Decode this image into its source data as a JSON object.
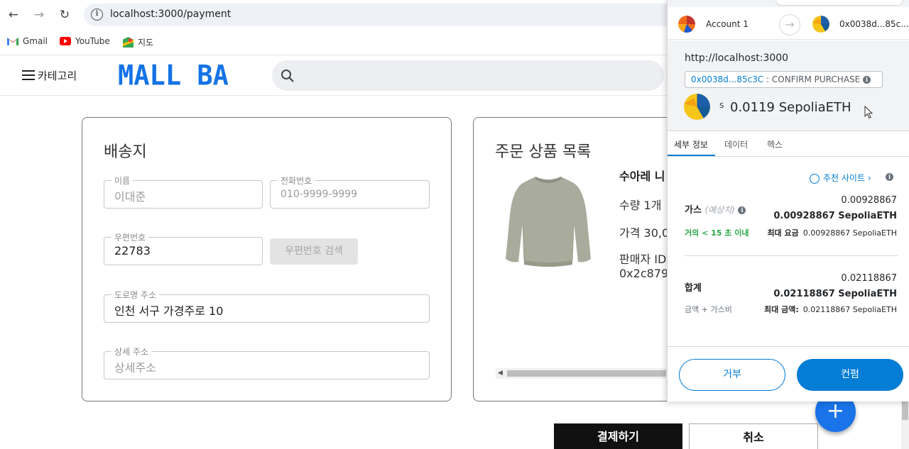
{
  "browser": {
    "url": "localhost:3000/payment",
    "bookmarks": [
      {
        "label": "Gmail",
        "icon": "gmail-icon"
      },
      {
        "label": "YouTube",
        "icon": "youtube-icon"
      },
      {
        "label": "지도",
        "icon": "maps-icon"
      }
    ]
  },
  "site": {
    "category_label": "카테고리",
    "logo": "MALL BA"
  },
  "shipping": {
    "title": "배송지",
    "name_label": "이름",
    "name_placeholder": "이대준",
    "phone_label": "전화번호",
    "phone_placeholder": "010-9999-9999",
    "zip_label": "우편번호",
    "zip_value": "22783",
    "zip_search_button": "우편번호 검색",
    "road_label": "도로명 주소",
    "road_value": "인천 서구 가경주로 10",
    "detail_label": "상세 주소",
    "detail_placeholder": "상세주소"
  },
  "order": {
    "title": "주문 상품 목록",
    "product_name": "수아레 니",
    "quantity": "수량 1개",
    "price": "가격 30,0",
    "seller_label": "판매자 ID",
    "seller_id": "0x2c879"
  },
  "actions": {
    "pay": "결제하기",
    "cancel": "취소",
    "fab": "+"
  },
  "metamask": {
    "account_name": "Account 1",
    "to_address": "0x0038d...85c...",
    "origin": "http://localhost:3000",
    "method_address": "0x0038d...85c3C",
    "method_label": ": CONFIRM PURCHASE",
    "amount_symbol": "S",
    "amount": "0.0119 SepoliaETH",
    "tabs": [
      "세부 정보",
      "데이터",
      "헥스"
    ],
    "recommended_site": "추천 사이트",
    "gas_label": "가스",
    "gas_sub": "(예상치)",
    "gas_small": "0.00928867",
    "gas_bold": "0.00928867 SepoliaETH",
    "gas_time": "거의 < 15 초 이내",
    "gas_max_label": "최대 요금",
    "gas_max_value": "0.00928867 SepoliaETH",
    "total_label": "합계",
    "total_small": "0.02118867",
    "total_bold": "0.02118867 SepoliaETH",
    "total_sub": "금액 + 가스비",
    "total_max_label": "최대 금액:",
    "total_max_value": "0.02118867 SepoliaETH",
    "reject": "거부",
    "confirm": "컨펌"
  },
  "colors": {
    "brand": "#1473e6",
    "metamask_blue": "#037dd6",
    "fab": "#1a73e8",
    "green": "#28a745"
  }
}
